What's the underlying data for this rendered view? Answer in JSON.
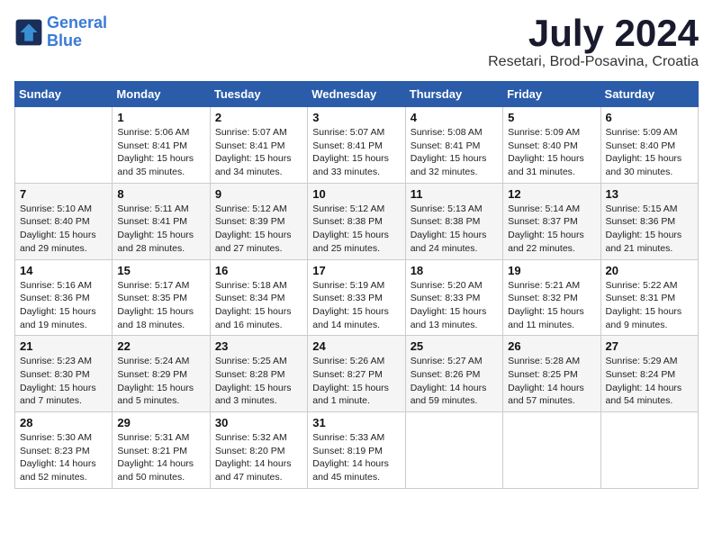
{
  "header": {
    "logo_line1": "General",
    "logo_line2": "Blue",
    "month": "July 2024",
    "location": "Resetari, Brod-Posavina, Croatia"
  },
  "weekdays": [
    "Sunday",
    "Monday",
    "Tuesday",
    "Wednesday",
    "Thursday",
    "Friday",
    "Saturday"
  ],
  "weeks": [
    [
      null,
      {
        "day": "1",
        "sunrise": "5:06 AM",
        "sunset": "8:41 PM",
        "daylight": "15 hours and 35 minutes."
      },
      {
        "day": "2",
        "sunrise": "5:07 AM",
        "sunset": "8:41 PM",
        "daylight": "15 hours and 34 minutes."
      },
      {
        "day": "3",
        "sunrise": "5:07 AM",
        "sunset": "8:41 PM",
        "daylight": "15 hours and 33 minutes."
      },
      {
        "day": "4",
        "sunrise": "5:08 AM",
        "sunset": "8:41 PM",
        "daylight": "15 hours and 32 minutes."
      },
      {
        "day": "5",
        "sunrise": "5:09 AM",
        "sunset": "8:40 PM",
        "daylight": "15 hours and 31 minutes."
      },
      {
        "day": "6",
        "sunrise": "5:09 AM",
        "sunset": "8:40 PM",
        "daylight": "15 hours and 30 minutes."
      }
    ],
    [
      {
        "day": "7",
        "sunrise": "5:10 AM",
        "sunset": "8:40 PM",
        "daylight": "15 hours and 29 minutes."
      },
      {
        "day": "8",
        "sunrise": "5:11 AM",
        "sunset": "8:41 PM",
        "daylight": "15 hours and 28 minutes."
      },
      {
        "day": "9",
        "sunrise": "5:12 AM",
        "sunset": "8:39 PM",
        "daylight": "15 hours and 27 minutes."
      },
      {
        "day": "10",
        "sunrise": "5:12 AM",
        "sunset": "8:38 PM",
        "daylight": "15 hours and 25 minutes."
      },
      {
        "day": "11",
        "sunrise": "5:13 AM",
        "sunset": "8:38 PM",
        "daylight": "15 hours and 24 minutes."
      },
      {
        "day": "12",
        "sunrise": "5:14 AM",
        "sunset": "8:37 PM",
        "daylight": "15 hours and 22 minutes."
      },
      {
        "day": "13",
        "sunrise": "5:15 AM",
        "sunset": "8:36 PM",
        "daylight": "15 hours and 21 minutes."
      }
    ],
    [
      {
        "day": "14",
        "sunrise": "5:16 AM",
        "sunset": "8:36 PM",
        "daylight": "15 hours and 19 minutes."
      },
      {
        "day": "15",
        "sunrise": "5:17 AM",
        "sunset": "8:35 PM",
        "daylight": "15 hours and 18 minutes."
      },
      {
        "day": "16",
        "sunrise": "5:18 AM",
        "sunset": "8:34 PM",
        "daylight": "15 hours and 16 minutes."
      },
      {
        "day": "17",
        "sunrise": "5:19 AM",
        "sunset": "8:33 PM",
        "daylight": "15 hours and 14 minutes."
      },
      {
        "day": "18",
        "sunrise": "5:20 AM",
        "sunset": "8:33 PM",
        "daylight": "15 hours and 13 minutes."
      },
      {
        "day": "19",
        "sunrise": "5:21 AM",
        "sunset": "8:32 PM",
        "daylight": "15 hours and 11 minutes."
      },
      {
        "day": "20",
        "sunrise": "5:22 AM",
        "sunset": "8:31 PM",
        "daylight": "15 hours and 9 minutes."
      }
    ],
    [
      {
        "day": "21",
        "sunrise": "5:23 AM",
        "sunset": "8:30 PM",
        "daylight": "15 hours and 7 minutes."
      },
      {
        "day": "22",
        "sunrise": "5:24 AM",
        "sunset": "8:29 PM",
        "daylight": "15 hours and 5 minutes."
      },
      {
        "day": "23",
        "sunrise": "5:25 AM",
        "sunset": "8:28 PM",
        "daylight": "15 hours and 3 minutes."
      },
      {
        "day": "24",
        "sunrise": "5:26 AM",
        "sunset": "8:27 PM",
        "daylight": "15 hours and 1 minute."
      },
      {
        "day": "25",
        "sunrise": "5:27 AM",
        "sunset": "8:26 PM",
        "daylight": "14 hours and 59 minutes."
      },
      {
        "day": "26",
        "sunrise": "5:28 AM",
        "sunset": "8:25 PM",
        "daylight": "14 hours and 57 minutes."
      },
      {
        "day": "27",
        "sunrise": "5:29 AM",
        "sunset": "8:24 PM",
        "daylight": "14 hours and 54 minutes."
      }
    ],
    [
      {
        "day": "28",
        "sunrise": "5:30 AM",
        "sunset": "8:23 PM",
        "daylight": "14 hours and 52 minutes."
      },
      {
        "day": "29",
        "sunrise": "5:31 AM",
        "sunset": "8:21 PM",
        "daylight": "14 hours and 50 minutes."
      },
      {
        "day": "30",
        "sunrise": "5:32 AM",
        "sunset": "8:20 PM",
        "daylight": "14 hours and 47 minutes."
      },
      {
        "day": "31",
        "sunrise": "5:33 AM",
        "sunset": "8:19 PM",
        "daylight": "14 hours and 45 minutes."
      },
      null,
      null,
      null
    ]
  ]
}
